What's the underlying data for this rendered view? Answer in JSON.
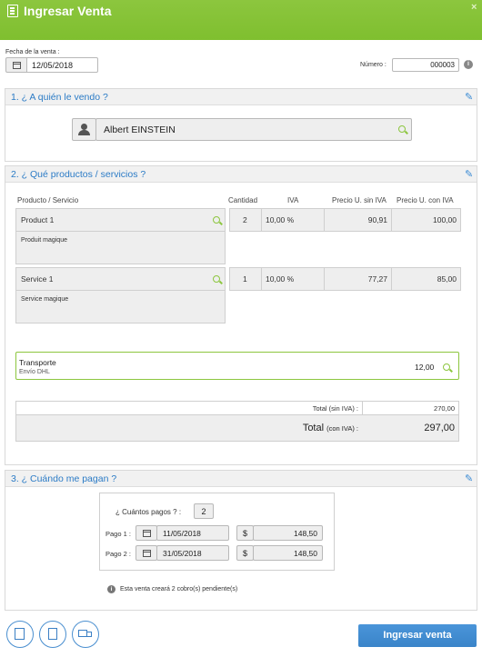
{
  "header": {
    "title": "Ingresar Venta",
    "close": "×"
  },
  "fecha": {
    "label": "Fecha de la venta :",
    "value": "12/05/2018"
  },
  "numero": {
    "label": "Número :",
    "value": "000003"
  },
  "section1": {
    "title": "1. ¿ A quién le vendo ?",
    "client": "Albert EINSTEIN"
  },
  "section2": {
    "title": "2. ¿ Qué productos / servicios ?",
    "columns": [
      "Producto / Servicio",
      "Cantidad",
      "IVA",
      "Precio U. sin IVA",
      "Precio U. con IVA"
    ],
    "rows": [
      {
        "name": "Product 1",
        "desc": "Produit magique",
        "qty": "2",
        "iva": "10,00 %",
        "price_ex": "90,91",
        "price_inc": "100,00"
      },
      {
        "name": "Service 1",
        "desc": "Service magique",
        "qty": "1",
        "iva": "10,00 %",
        "price_ex": "77,27",
        "price_inc": "85,00"
      }
    ],
    "shipping": {
      "name": "Transporte",
      "desc": "Envío DHL",
      "value": "12,00"
    },
    "total_ex_label": "Total (sin IVA) :",
    "total_ex_value": "270,00",
    "total_label": "Total",
    "total_label_small": "(con IVA) :",
    "total_value": "297,00"
  },
  "section3": {
    "title": "3. ¿ Cuándo me pagan ?",
    "count_label": "¿ Cuántos pagos ? :",
    "count_value": "2",
    "payments": [
      {
        "label": "Pago 1 :",
        "date": "11/05/2018",
        "currency": "$",
        "amount": "148,50"
      },
      {
        "label": "Pago 2 :",
        "date": "31/05/2018",
        "currency": "$",
        "amount": "148,50"
      }
    ],
    "info": "Esta venta creará 2 cobro(s) pendiente(s)"
  },
  "footer": {
    "submit": "Ingresar venta"
  }
}
